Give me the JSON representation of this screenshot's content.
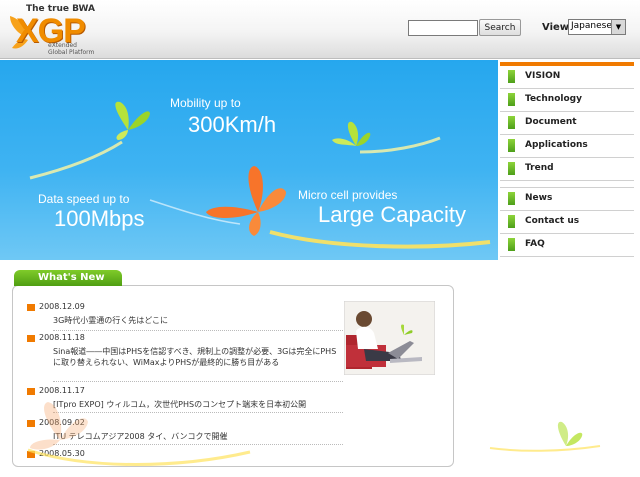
{
  "header": {
    "logo": {
      "tagline": "The true BWA",
      "wordmark": "XGP",
      "sub_line1": "eXtended",
      "sub_line2": "Global Platform"
    },
    "search": {
      "value": "",
      "button_label": "Search"
    },
    "view": {
      "label": "View",
      "selected": "Japanese"
    }
  },
  "banner": {
    "mobility_label": "Mobility up to",
    "mobility_value": "300Km/h",
    "speed_label": "Data speed up to",
    "speed_value": "100Mbps",
    "cell_label": "Micro cell provides",
    "cell_value": "Large Capacity"
  },
  "menu": {
    "items": [
      {
        "label": "VISION"
      },
      {
        "label": "Technology"
      },
      {
        "label": "Document"
      },
      {
        "label": "Applications"
      },
      {
        "label": "Trend"
      },
      {
        "label": "News"
      },
      {
        "label": "Contact us"
      },
      {
        "label": "FAQ"
      }
    ]
  },
  "whats_new": {
    "title": "What's New",
    "items": [
      {
        "date": "2008.12.09",
        "text": "3G時代小霊通の行く先はどこに"
      },
      {
        "date": "2008.11.18",
        "text": "Sina報道――中国はPHSを信認すべき、規制上の調整が必要、3Gは完全にPHSに取り替えられない、WiMaxよりPHSが最終的に勝ち目がある"
      },
      {
        "date": "2008.11.17",
        "text": "[ITpro EXPO] ウィルコム，次世代PHSのコンセプト端末を日本初公開"
      },
      {
        "date": "2008.09.02",
        "text": "ITU テレコムアジア2008 タイ、バンコクで開催"
      },
      {
        "date": "2008.05.30",
        "text": ""
      }
    ]
  },
  "colors": {
    "accent": "#f07a00",
    "menu_marker": "#6cbb26",
    "banner_sky": "#35aff0",
    "tab_green": "#66b51f"
  }
}
